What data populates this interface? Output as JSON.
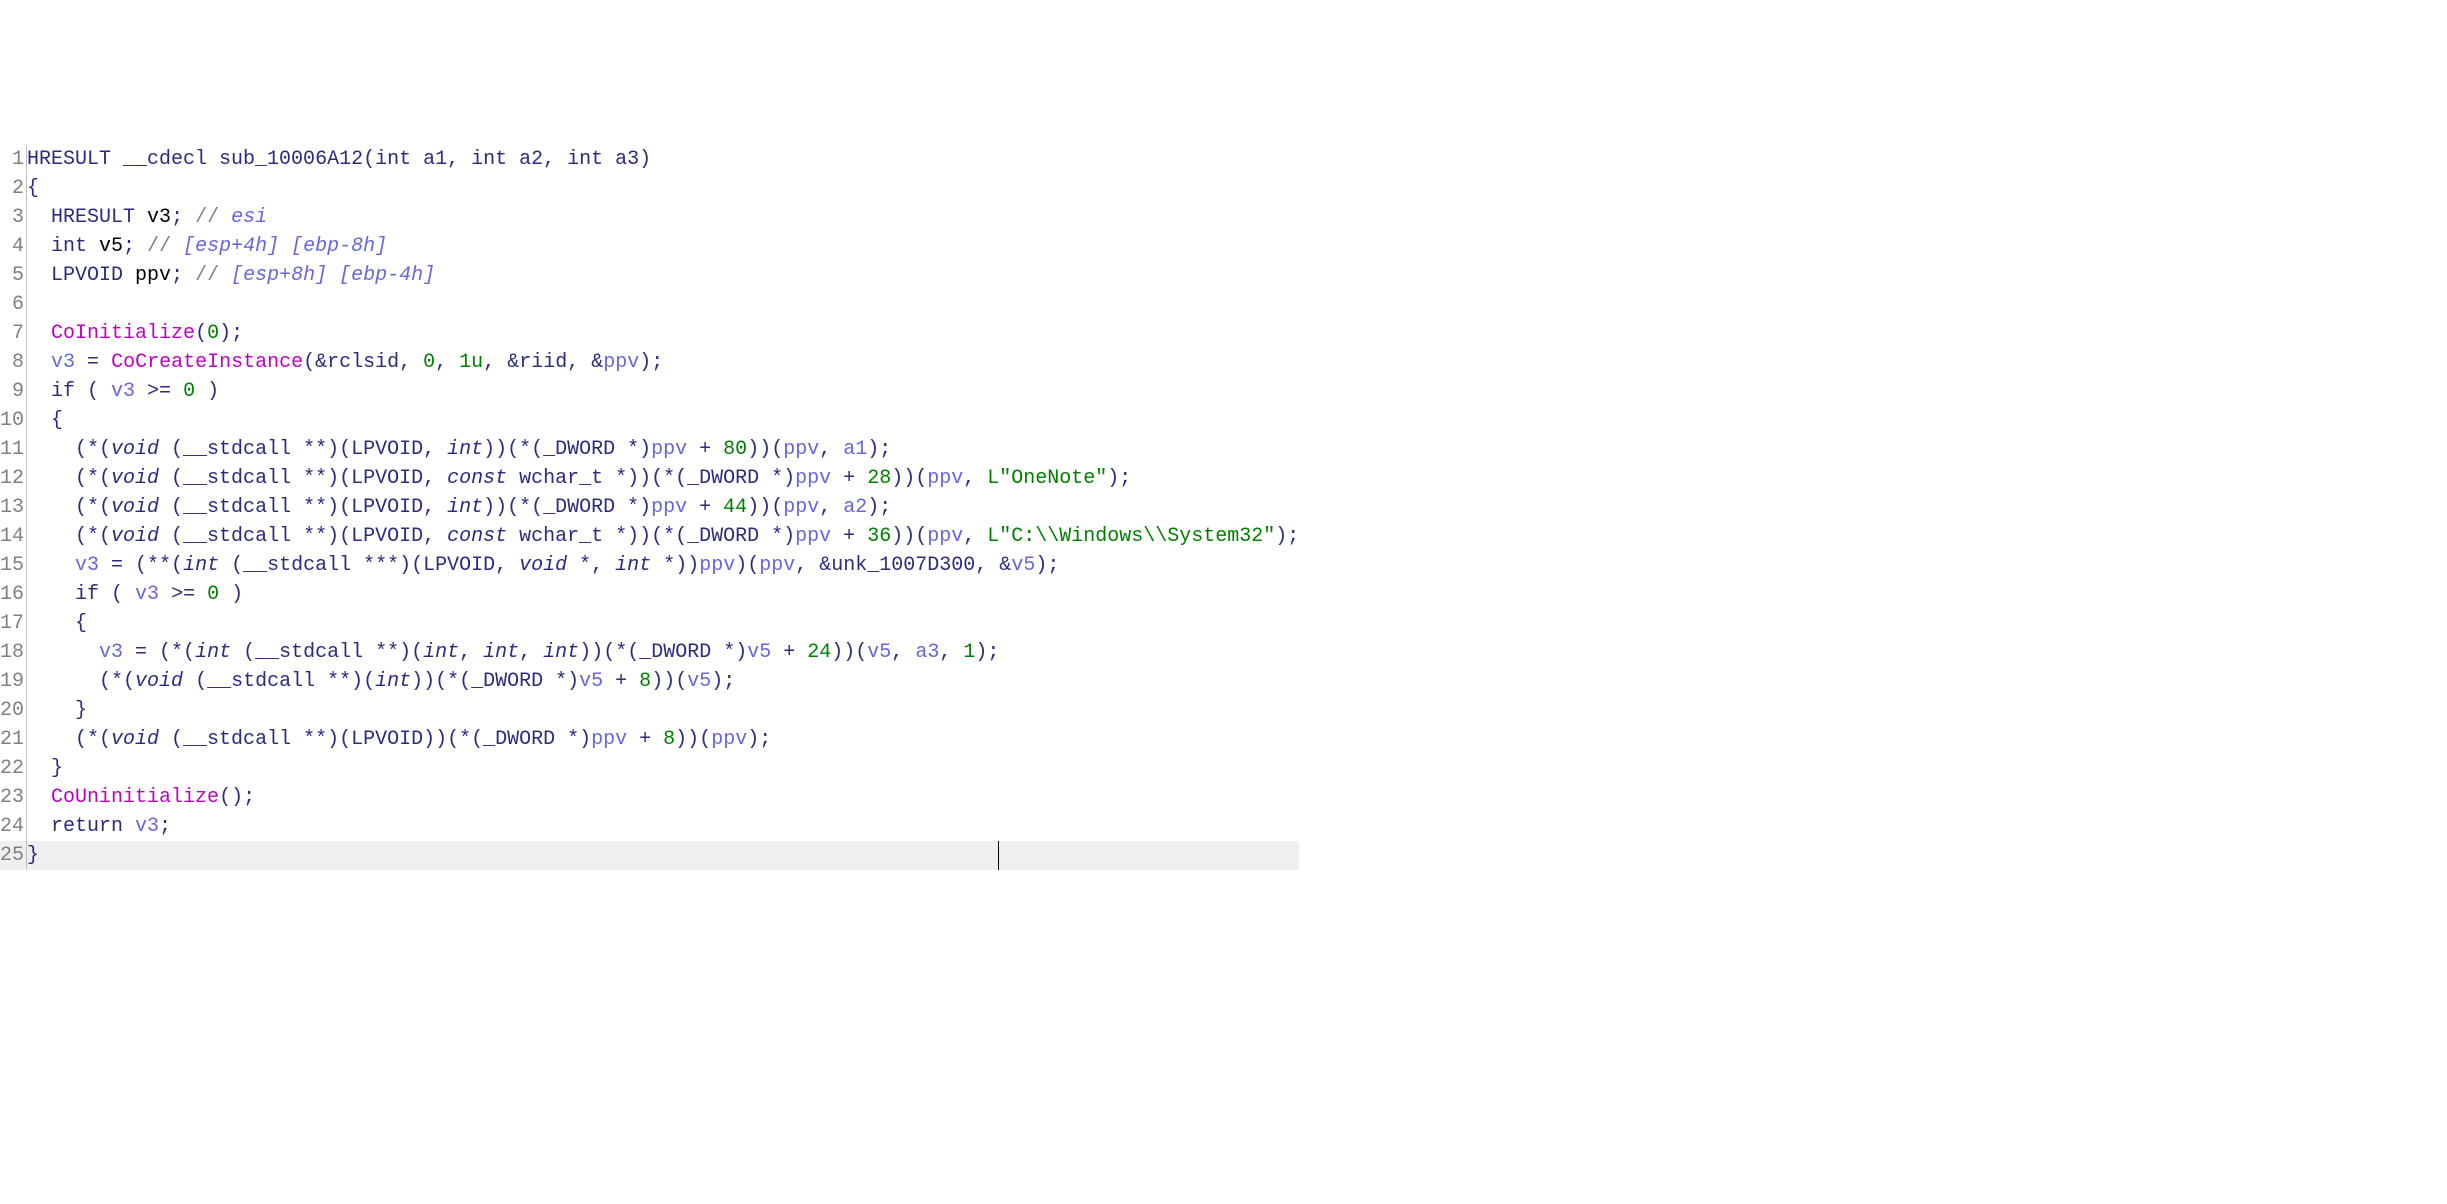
{
  "total_lines": 25,
  "cursor_line": 25,
  "tokens": {
    "l1": [
      [
        "t-kw",
        "HRESULT __cdecl sub_10006A12("
      ],
      [
        "t-kw",
        "int"
      ],
      [
        "t-kw",
        " a1, "
      ],
      [
        "t-kw",
        "int"
      ],
      [
        "t-kw",
        " a2, "
      ],
      [
        "t-kw",
        "int"
      ],
      [
        "t-kw",
        " a3)"
      ]
    ],
    "l2": [
      [
        "t-punc",
        "{"
      ]
    ],
    "l3": [
      [
        "t-kw",
        "  HRESULT "
      ],
      [
        "t-cvar",
        "v3"
      ],
      [
        "t-punc",
        "; "
      ],
      [
        "t-comm",
        "// "
      ],
      [
        "t-creg",
        "esi"
      ]
    ],
    "l4": [
      [
        "t-kw",
        "  int "
      ],
      [
        "t-cvar",
        "v5"
      ],
      [
        "t-punc",
        "; "
      ],
      [
        "t-comm",
        "// "
      ],
      [
        "t-creg",
        "[esp+4h] [ebp-8h]"
      ]
    ],
    "l5": [
      [
        "t-kw",
        "  LPVOID "
      ],
      [
        "t-cvar",
        "ppv"
      ],
      [
        "t-punc",
        "; "
      ],
      [
        "t-comm",
        "// "
      ],
      [
        "t-creg",
        "[esp+8h] [ebp-4h]"
      ]
    ],
    "l6": [
      [
        "t-kw",
        " "
      ]
    ],
    "l7": [
      [
        "t-kw",
        "  "
      ],
      [
        "t-call",
        "CoInitialize"
      ],
      [
        "t-punc",
        "("
      ],
      [
        "t-num",
        "0"
      ],
      [
        "t-punc",
        ");"
      ]
    ],
    "l8": [
      [
        "t-kw",
        "  "
      ],
      [
        "t-var",
        "v3"
      ],
      [
        "t-kw",
        " = "
      ],
      [
        "t-call",
        "CoCreateInstance"
      ],
      [
        "t-punc",
        "(&"
      ],
      [
        "t-kw",
        "rclsid"
      ],
      [
        "t-punc",
        ", "
      ],
      [
        "t-num",
        "0"
      ],
      [
        "t-punc",
        ", "
      ],
      [
        "t-num",
        "1u"
      ],
      [
        "t-punc",
        ", &"
      ],
      [
        "t-kw",
        "riid"
      ],
      [
        "t-punc",
        ", &"
      ],
      [
        "t-var",
        "ppv"
      ],
      [
        "t-punc",
        ");"
      ]
    ],
    "l9": [
      [
        "t-kw",
        "  if ( "
      ],
      [
        "t-var",
        "v3"
      ],
      [
        "t-kw",
        " >= "
      ],
      [
        "t-num",
        "0"
      ],
      [
        "t-kw",
        " )"
      ]
    ],
    "l10": [
      [
        "t-punc",
        "  {"
      ]
    ],
    "l11": [
      [
        "t-kw",
        "    (*("
      ],
      [
        "t-run",
        "void"
      ],
      [
        "t-kw",
        " (__stdcall **)(LPVOID, "
      ],
      [
        "t-run",
        "int"
      ],
      [
        "t-kw",
        "))(*(_DWORD *)"
      ],
      [
        "t-var",
        "ppv"
      ],
      [
        "t-kw",
        " + "
      ],
      [
        "t-num",
        "80"
      ],
      [
        "t-kw",
        "))("
      ],
      [
        "t-var",
        "ppv"
      ],
      [
        "t-kw",
        ", "
      ],
      [
        "t-var",
        "a1"
      ],
      [
        "t-punc",
        ");"
      ]
    ],
    "l12": [
      [
        "t-kw",
        "    (*("
      ],
      [
        "t-run",
        "void"
      ],
      [
        "t-kw",
        " (__stdcall **)(LPVOID, "
      ],
      [
        "t-run",
        "const"
      ],
      [
        "t-kw",
        " wchar_t *))(*(_DWORD *)"
      ],
      [
        "t-var",
        "ppv"
      ],
      [
        "t-kw",
        " + "
      ],
      [
        "t-num",
        "28"
      ],
      [
        "t-kw",
        "))("
      ],
      [
        "t-var",
        "ppv"
      ],
      [
        "t-kw",
        ", "
      ],
      [
        "t-str",
        "L\"OneNote\""
      ],
      [
        "t-punc",
        ");"
      ]
    ],
    "l13": [
      [
        "t-kw",
        "    (*("
      ],
      [
        "t-run",
        "void"
      ],
      [
        "t-kw",
        " (__stdcall **)(LPVOID, "
      ],
      [
        "t-run",
        "int"
      ],
      [
        "t-kw",
        "))(*(_DWORD *)"
      ],
      [
        "t-var",
        "ppv"
      ],
      [
        "t-kw",
        " + "
      ],
      [
        "t-num",
        "44"
      ],
      [
        "t-kw",
        "))("
      ],
      [
        "t-var",
        "ppv"
      ],
      [
        "t-kw",
        ", "
      ],
      [
        "t-var",
        "a2"
      ],
      [
        "t-punc",
        ");"
      ]
    ],
    "l14": [
      [
        "t-kw",
        "    (*("
      ],
      [
        "t-run",
        "void"
      ],
      [
        "t-kw",
        " (__stdcall **)(LPVOID, "
      ],
      [
        "t-run",
        "const"
      ],
      [
        "t-kw",
        " wchar_t *))(*(_DWORD *)"
      ],
      [
        "t-var",
        "ppv"
      ],
      [
        "t-kw",
        " + "
      ],
      [
        "t-num",
        "36"
      ],
      [
        "t-kw",
        "))("
      ],
      [
        "t-var",
        "ppv"
      ],
      [
        "t-kw",
        ", "
      ],
      [
        "t-str",
        "L\"C:\\\\Windows\\\\System32\""
      ],
      [
        "t-punc",
        ");"
      ]
    ],
    "l15": [
      [
        "t-kw",
        "    "
      ],
      [
        "t-var",
        "v3"
      ],
      [
        "t-kw",
        " = (**("
      ],
      [
        "t-run",
        "int"
      ],
      [
        "t-kw",
        " (__stdcall ***)(LPVOID, "
      ],
      [
        "t-run",
        "void"
      ],
      [
        "t-kw",
        " *, "
      ],
      [
        "t-run",
        "int"
      ],
      [
        "t-kw",
        " *))"
      ],
      [
        "t-var",
        "ppv"
      ],
      [
        "t-kw",
        ")("
      ],
      [
        "t-var",
        "ppv"
      ],
      [
        "t-kw",
        ", &"
      ],
      [
        "t-kw",
        "unk_1007D300"
      ],
      [
        "t-kw",
        ", &"
      ],
      [
        "t-var",
        "v5"
      ],
      [
        "t-punc",
        ");"
      ]
    ],
    "l16": [
      [
        "t-kw",
        "    if ( "
      ],
      [
        "t-var",
        "v3"
      ],
      [
        "t-kw",
        " >= "
      ],
      [
        "t-num",
        "0"
      ],
      [
        "t-kw",
        " )"
      ]
    ],
    "l17": [
      [
        "t-punc",
        "    {"
      ]
    ],
    "l18": [
      [
        "t-kw",
        "      "
      ],
      [
        "t-var",
        "v3"
      ],
      [
        "t-kw",
        " = (*("
      ],
      [
        "t-run",
        "int"
      ],
      [
        "t-kw",
        " (__stdcall **)("
      ],
      [
        "t-run",
        "int"
      ],
      [
        "t-kw",
        ", "
      ],
      [
        "t-run",
        "int"
      ],
      [
        "t-kw",
        ", "
      ],
      [
        "t-run",
        "int"
      ],
      [
        "t-kw",
        "))(*(_DWORD *)"
      ],
      [
        "t-var",
        "v5"
      ],
      [
        "t-kw",
        " + "
      ],
      [
        "t-num",
        "24"
      ],
      [
        "t-kw",
        "))("
      ],
      [
        "t-var",
        "v5"
      ],
      [
        "t-kw",
        ", "
      ],
      [
        "t-var",
        "a3"
      ],
      [
        "t-kw",
        ", "
      ],
      [
        "t-num",
        "1"
      ],
      [
        "t-punc",
        ");"
      ]
    ],
    "l19": [
      [
        "t-kw",
        "      (*("
      ],
      [
        "t-run",
        "void"
      ],
      [
        "t-kw",
        " (__stdcall **)("
      ],
      [
        "t-run",
        "int"
      ],
      [
        "t-kw",
        "))(*(_DWORD *)"
      ],
      [
        "t-var",
        "v5"
      ],
      [
        "t-kw",
        " + "
      ],
      [
        "t-num",
        "8"
      ],
      [
        "t-kw",
        "))("
      ],
      [
        "t-var",
        "v5"
      ],
      [
        "t-punc",
        ");"
      ]
    ],
    "l20": [
      [
        "t-punc",
        "    }"
      ]
    ],
    "l21": [
      [
        "t-kw",
        "    (*("
      ],
      [
        "t-run",
        "void"
      ],
      [
        "t-kw",
        " (__stdcall **)(LPVOID))(*(_DWORD *)"
      ],
      [
        "t-var",
        "ppv"
      ],
      [
        "t-kw",
        " + "
      ],
      [
        "t-num",
        "8"
      ],
      [
        "t-kw",
        "))("
      ],
      [
        "t-var",
        "ppv"
      ],
      [
        "t-punc",
        ");"
      ]
    ],
    "l22": [
      [
        "t-punc",
        "  }"
      ]
    ],
    "l23": [
      [
        "t-kw",
        "  "
      ],
      [
        "t-call",
        "CoUninitialize"
      ],
      [
        "t-punc",
        "();"
      ]
    ],
    "l24": [
      [
        "t-kw",
        "  return "
      ],
      [
        "t-var",
        "v3"
      ],
      [
        "t-punc",
        ";"
      ]
    ],
    "l25": [
      [
        "t-punc",
        "}"
      ]
    ]
  }
}
